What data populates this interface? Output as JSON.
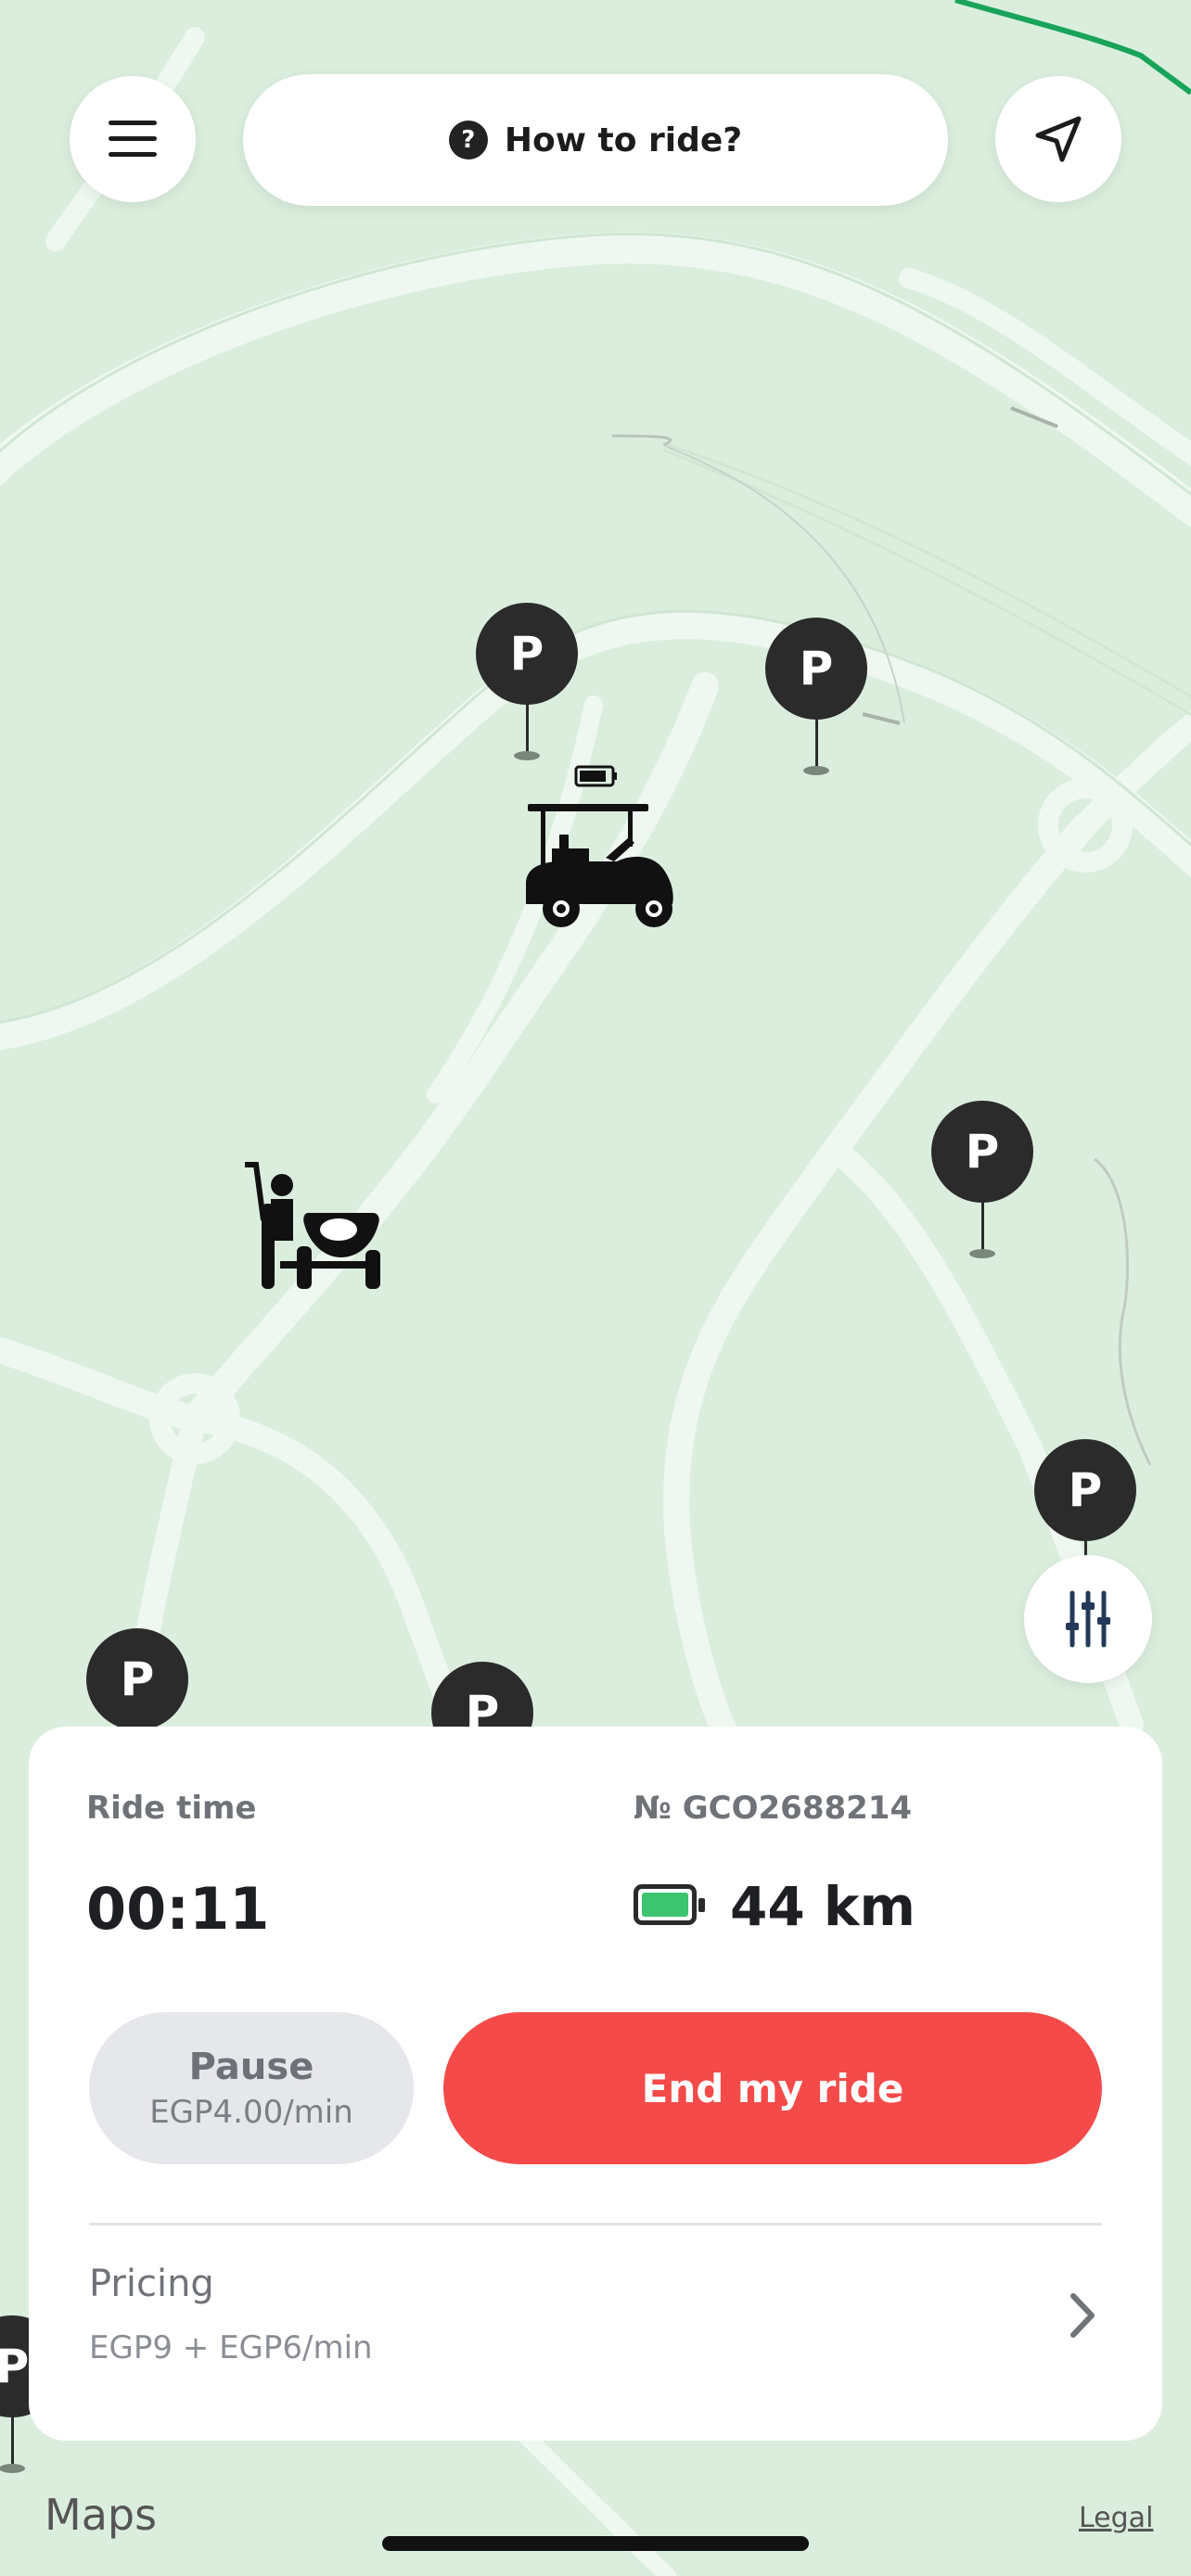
{
  "top_bar": {
    "menu_icon": "hamburger-icon",
    "help_icon_glyph": "?",
    "how_to_ride_label": "How to ride?",
    "locate_icon": "location-arrow-icon"
  },
  "map": {
    "parking_label": "P",
    "vehicles": [
      "golf-cart-icon",
      "sidecar-motorcycle-icon"
    ]
  },
  "filter_icon": "sliders-icon",
  "ride_panel": {
    "ride_time_label": "Ride time",
    "ride_time_value": "00:11",
    "vehicle_number": "№ GCO2688214",
    "battery_icon": "battery-full-icon",
    "battery_level": 1.0,
    "range": "44 km",
    "pause": {
      "label": "Pause",
      "price": "EGP4.00/min"
    },
    "end_ride_label": "End my ride",
    "pricing": {
      "title": "Pricing",
      "value": "EGP9 + EGP6/min",
      "chevron_icon": "chevron-right-icon"
    }
  },
  "footer": {
    "maps_logo_glyph": "",
    "maps_label": "Maps",
    "legal_label": "Legal"
  },
  "colors": {
    "map_bg": "#dbeedd",
    "road": "#eef8f0",
    "end_button": "#f44a49",
    "battery_fill": "#3cc470",
    "route": "#18a45a"
  }
}
